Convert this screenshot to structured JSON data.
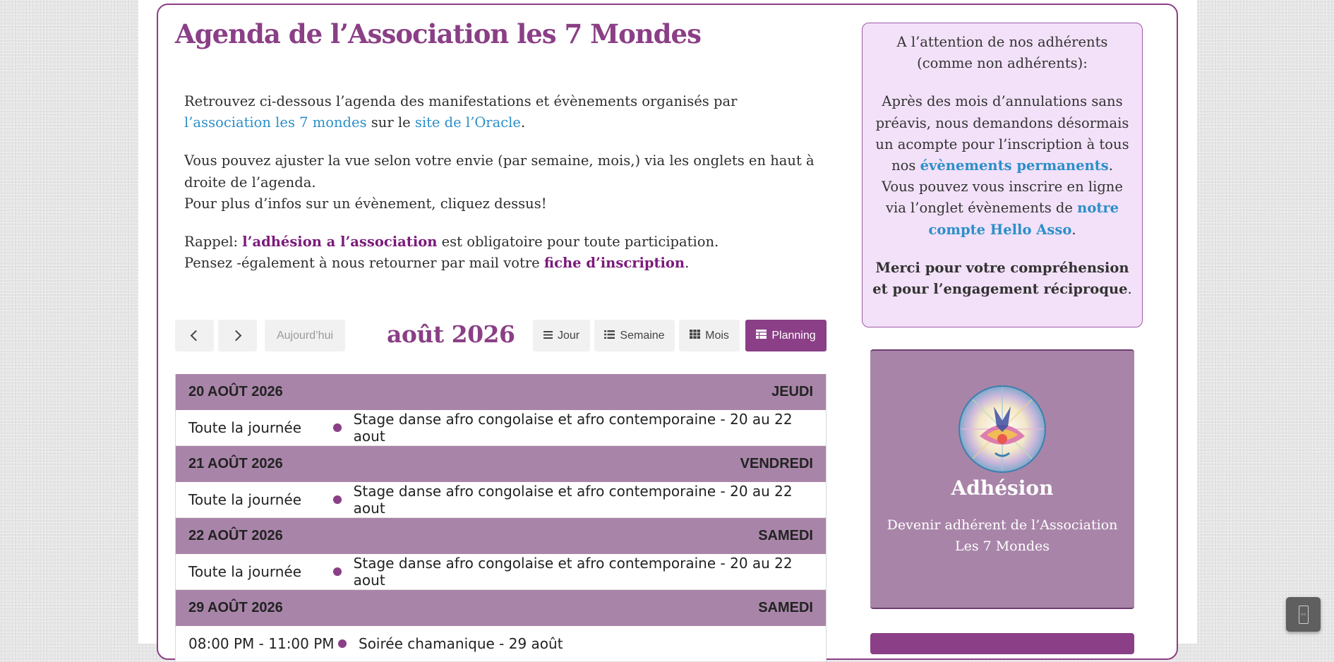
{
  "title": "Agenda de l’Association les 7 Mondes",
  "intro": {
    "p1_before": "Retrouvez ci-dessous l’agenda des manifestations et évènements organisés par ",
    "p1_link1": "l’association les 7 mondes",
    "p1_mid": " sur le ",
    "p1_link2": "site de l’Oracle",
    "p1_end": ".",
    "p2_line1": "Vous pouvez ajuster la vue selon votre envie (par semaine, mois,) via les onglets en haut à droite de l’agenda.",
    "p2_line2": "Pour plus d’infos sur un évènement, cliquez dessus!",
    "p3_before": "Rappel: ",
    "p3_link": "l’adhésion a l’association",
    "p3_after": " est obligatoire pour toute participation.",
    "p3_line2_before": "Pensez -également à nous retourner par mail votre ",
    "p3_line2_link": "fiche d’inscription",
    "p3_line2_end": "."
  },
  "toolbar": {
    "today_label": "Aujourd’hui",
    "current_period": "août 2026",
    "views": [
      {
        "label": "Jour",
        "icon": "list-icon"
      },
      {
        "label": "Semaine",
        "icon": "list-icon"
      },
      {
        "label": "Mois",
        "icon": "grid-icon"
      },
      {
        "label": "Planning",
        "icon": "table-icon",
        "active": true
      }
    ]
  },
  "schedule": [
    {
      "date": "20 AOÛT 2026",
      "weekday": "JEUDI",
      "events": [
        {
          "time": "Toute la journée",
          "title": "Stage danse afro congolaise et afro contemporaine - 20 au 22 aout"
        }
      ]
    },
    {
      "date": "21 AOÛT 2026",
      "weekday": "VENDREDI",
      "events": [
        {
          "time": "Toute la journée",
          "title": "Stage danse afro congolaise et afro contemporaine - 20 au 22 aout"
        }
      ]
    },
    {
      "date": "22 AOÛT 2026",
      "weekday": "SAMEDI",
      "events": [
        {
          "time": "Toute la journée",
          "title": "Stage danse afro congolaise et afro contemporaine - 20 au 22 aout"
        }
      ]
    },
    {
      "date": "29 AOÛT 2026",
      "weekday": "SAMEDI",
      "events": [
        {
          "time": "08:00 PM - 11:00 PM",
          "title": "Soirée chamanique - 29 août"
        }
      ]
    }
  ],
  "notice": {
    "p1": "A l’attention de nos adhérents (comme non adhérents):",
    "p2_before": "Après des mois d’annulations sans préavis, nous demandons désormais un acompte pour l’inscription à tous nos ",
    "p2_link": "évènements permanents",
    "p2_end": ".",
    "p3_before": "Vous pouvez vous inscrire en ligne via l’onglet évènements de ",
    "p3_link": "notre compte Hello Asso",
    "p3_end": ".",
    "p4_bold": "Merci pour votre compréhension et pour l’engagement réciproque",
    "p4_end": "."
  },
  "adhesion": {
    "title": "Adhésion",
    "description": "Devenir adhérent de l’Association Les 7 Mondes"
  },
  "float_button": {
    "icon": "scroll-to-top-icon",
    "glyph": "▫▫"
  },
  "colors": {
    "brand": "#8a3f86",
    "header_bg": "#a885a8",
    "notice_bg": "#f2e1f8",
    "link": "#2c8fc9"
  }
}
